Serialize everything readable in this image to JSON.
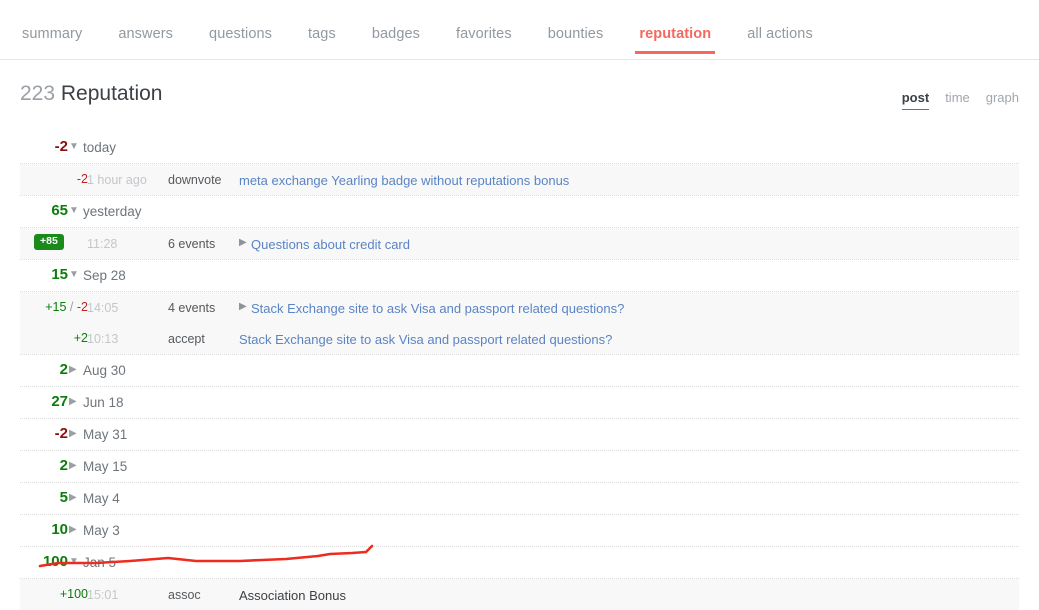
{
  "tabs": [
    {
      "label": "summary",
      "active": false
    },
    {
      "label": "answers",
      "active": false
    },
    {
      "label": "questions",
      "active": false
    },
    {
      "label": "tags",
      "active": false
    },
    {
      "label": "badges",
      "active": false
    },
    {
      "label": "favorites",
      "active": false
    },
    {
      "label": "bounties",
      "active": false
    },
    {
      "label": "reputation",
      "active": true
    },
    {
      "label": "all actions",
      "active": false
    }
  ],
  "header": {
    "count": "223",
    "title": "Reputation",
    "view_options": [
      {
        "label": "post",
        "active": true
      },
      {
        "label": "time",
        "active": false
      },
      {
        "label": "graph",
        "active": false
      }
    ]
  },
  "colors": {
    "accent": "#f4685f",
    "positive": "#0a7d0a",
    "negative": "#c02222",
    "badge_green": "#1a8a1a",
    "link_blue": "#5a84c4",
    "annotation_red": "#ee2b1f"
  },
  "groups": [
    {
      "value": "-2",
      "sign": "neg",
      "date": "today",
      "expanded": true,
      "toggle_icon": "triangle-down-icon",
      "rows": [
        {
          "value": "-2",
          "sign": "neg",
          "badge": null,
          "time": "1 hour ago",
          "type": "downvote",
          "title": "meta exchange Yearling badge without reputations bonus",
          "is_link": true,
          "has_expander": false
        }
      ]
    },
    {
      "value": "65",
      "sign": "pos",
      "date": "yesterday",
      "expanded": true,
      "toggle_icon": "triangle-down-icon",
      "rows": [
        {
          "value": null,
          "sign": "pos",
          "badge": "+85",
          "time": "11:28",
          "type": "6 events",
          "title": "Questions about credit card",
          "is_link": true,
          "has_expander": true
        }
      ]
    },
    {
      "value": "15",
      "sign": "pos",
      "date": "Sep 28",
      "expanded": true,
      "toggle_icon": "triangle-down-icon",
      "rows": [
        {
          "value": "+15 / -2",
          "sign": "mixed",
          "badge": null,
          "time": "14:05",
          "type": "4 events",
          "title": "Stack Exchange site to ask Visa and passport related questions?",
          "is_link": true,
          "has_expander": true
        },
        {
          "value": "+2",
          "sign": "pos",
          "badge": null,
          "time": "10:13",
          "type": "accept",
          "title": "Stack Exchange site to ask Visa and passport related questions?",
          "is_link": true,
          "has_expander": false
        }
      ]
    },
    {
      "value": "2",
      "sign": "pos",
      "date": "Aug 30",
      "expanded": false,
      "toggle_icon": "triangle-right-icon",
      "rows": []
    },
    {
      "value": "27",
      "sign": "pos",
      "date": "Jun 18",
      "expanded": false,
      "toggle_icon": "triangle-right-icon",
      "rows": []
    },
    {
      "value": "-2",
      "sign": "neg",
      "date": "May 31",
      "expanded": false,
      "toggle_icon": "triangle-right-icon",
      "rows": []
    },
    {
      "value": "2",
      "sign": "pos",
      "date": "May 15",
      "expanded": false,
      "toggle_icon": "triangle-right-icon",
      "rows": []
    },
    {
      "value": "5",
      "sign": "pos",
      "date": "May 4",
      "expanded": false,
      "toggle_icon": "triangle-right-icon",
      "rows": []
    },
    {
      "value": "10",
      "sign": "pos",
      "date": "May 3",
      "expanded": false,
      "toggle_icon": "triangle-right-icon",
      "rows": []
    },
    {
      "value": "100",
      "sign": "pos",
      "date": "Jan 5",
      "expanded": true,
      "toggle_icon": "triangle-down-icon",
      "rows": [
        {
          "value": "+100",
          "sign": "pos",
          "badge": null,
          "time": "15:01",
          "type": "assoc",
          "title": "Association Bonus",
          "is_link": false,
          "has_expander": false
        }
      ]
    }
  ],
  "annotation": {
    "type": "freehand-red-underline",
    "present": true
  }
}
